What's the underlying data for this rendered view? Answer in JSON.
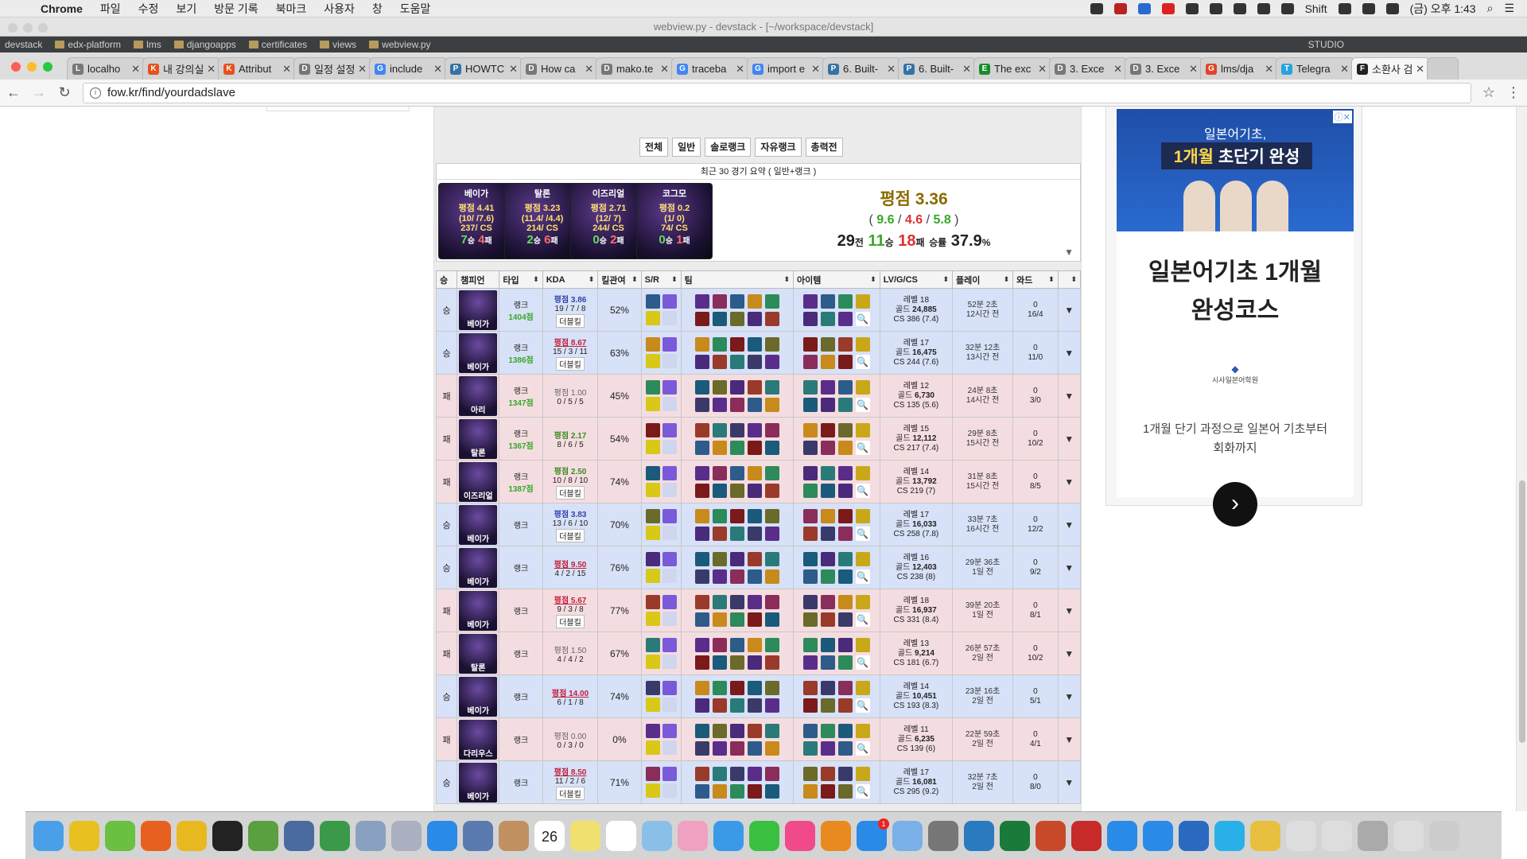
{
  "menubar": {
    "app": "Chrome",
    "items": [
      "파일",
      "수정",
      "보기",
      "방문 기록",
      "북마크",
      "사용자",
      "창",
      "도움말"
    ],
    "shift": "Shift",
    "clock": "(금) 오후 1:43"
  },
  "ide": {
    "title": "webview.py - devstack - [~/workspace/devstack]",
    "crumbs": [
      "devstack",
      "edx-platform",
      "lms",
      "djangoapps",
      "certificates",
      "views",
      "webview.py"
    ],
    "run_config": "STUDIO"
  },
  "tabs": [
    {
      "title": "localho",
      "fav": "L",
      "color": "#777"
    },
    {
      "title": "내 강의실",
      "fav": "K",
      "color": "#e8501c"
    },
    {
      "title": "Attribut",
      "fav": "K",
      "color": "#e8501c"
    },
    {
      "title": "일정 설정",
      "fav": "D",
      "color": "#777"
    },
    {
      "title": "include",
      "fav": "G",
      "color": "#4285f4"
    },
    {
      "title": "HOWTC",
      "fav": "P",
      "color": "#3572a5"
    },
    {
      "title": "How ca",
      "fav": "D",
      "color": "#777"
    },
    {
      "title": "mako.te",
      "fav": "D",
      "color": "#777"
    },
    {
      "title": "traceba",
      "fav": "G",
      "color": "#4285f4"
    },
    {
      "title": "import e",
      "fav": "G",
      "color": "#4285f4"
    },
    {
      "title": "6. Built-",
      "fav": "P",
      "color": "#3572a5"
    },
    {
      "title": "6. Built-",
      "fav": "P",
      "color": "#3572a5"
    },
    {
      "title": "The exc",
      "fav": "E",
      "color": "#1b8a2a"
    },
    {
      "title": "3. Exce",
      "fav": "D",
      "color": "#777"
    },
    {
      "title": "3. Exce",
      "fav": "D",
      "color": "#777"
    },
    {
      "title": "lms/dja",
      "fav": "G",
      "color": "#e24329"
    },
    {
      "title": "Telegra",
      "fav": "T",
      "color": "#2aa2de"
    },
    {
      "title": "소환사 검",
      "fav": "F",
      "color": "#222",
      "active": true
    }
  ],
  "address": {
    "url": "fow.kr/find/yourdadslave"
  },
  "filters": [
    "전체",
    "일반",
    "솔로랭크",
    "자유랭크",
    "총력전"
  ],
  "summary": {
    "title": "최근 30 경기 요약 ( 일반+랭크 )",
    "cards": [
      {
        "name": "베이가",
        "rating": "평점 4.41",
        "kda": "(10/ /7.6)",
        "cs": "237/ CS",
        "wins": "7",
        "win_label": "승",
        "losses": "4",
        "loss_label": "패"
      },
      {
        "name": "탈론",
        "rating": "평점 3.23",
        "kda": "(11.4/ /4.4)",
        "cs": "214/ CS",
        "wins": "2",
        "win_label": "승",
        "losses": "6",
        "loss_label": "패"
      },
      {
        "name": "이즈리얼",
        "rating": "평점 2.71",
        "kda": "(12/ 7)",
        "cs": "244/ CS",
        "wins": "0",
        "win_label": "승",
        "losses": "2",
        "loss_label": "패"
      },
      {
        "name": "코그모",
        "rating": "평점 0.2",
        "kda": "(1/ 0)",
        "cs": "74/ CS",
        "wins": "0",
        "win_label": "승",
        "losses": "1",
        "loss_label": "패"
      }
    ],
    "rating": "평점 3.36",
    "kda_open": "(",
    "kda_k": "9.6",
    "kda_d": "4.6",
    "kda_a": "5.8",
    "kda_close": ")",
    "games": "29",
    "games_label": "전",
    "wins": "11",
    "wins_label": "승",
    "losses": "18",
    "losses_label": "패",
    "rate_label": "승률",
    "rate": "37.9",
    "rate_unit": "%",
    "arrow": "▼"
  },
  "table": {
    "headers": [
      "승",
      "챔피언",
      "타입",
      "KDA",
      "킬관여",
      "S/R",
      "팀",
      "아이템",
      "LV/G/CS",
      "플레이",
      "와드",
      ""
    ],
    "rows": [
      {
        "result": "승",
        "win": true,
        "champ": "베이가",
        "type": "랭크",
        "lp": "1404점",
        "rating": "평점 3.86",
        "rclass": "mid",
        "kda": "19 / 7 / 8",
        "tag": "더블킬",
        "kp": "52%",
        "level": "레벨 18",
        "gold_label": "골드",
        "gold": "24,885",
        "cs": "CS 386 (7.4)",
        "dur": "52분 2초",
        "ago": "12시간 전",
        "ward1": "0",
        "ward2": "16/4"
      },
      {
        "result": "승",
        "win": true,
        "champ": "베이가",
        "type": "랭크",
        "lp": "1386점",
        "rating": "평점 8.67",
        "rclass": "hi",
        "kda": "15 / 3 / 11",
        "tag": "더블킬",
        "kp": "63%",
        "level": "레벨 17",
        "gold_label": "골드",
        "gold": "16,475",
        "cs": "CS 244 (7.6)",
        "dur": "32분 12초",
        "ago": "13시간 전",
        "ward1": "0",
        "ward2": "11/0"
      },
      {
        "result": "패",
        "win": false,
        "champ": "아리",
        "type": "랭크",
        "lp": "1347점",
        "rating": "평점 1.00",
        "rclass": "low",
        "kda": "0 / 5 / 5",
        "tag": "",
        "kp": "45%",
        "level": "레벨 12",
        "gold_label": "골드",
        "gold": "6,730",
        "cs": "CS 135 (5.6)",
        "dur": "24분 8초",
        "ago": "14시간 전",
        "ward1": "0",
        "ward2": "3/0"
      },
      {
        "result": "패",
        "win": false,
        "champ": "탈론",
        "type": "랭크",
        "lp": "1367점",
        "rating": "평점 2.17",
        "rclass": "good",
        "kda": "8 / 6 / 5",
        "tag": "",
        "kp": "54%",
        "level": "레벨 15",
        "gold_label": "골드",
        "gold": "12,112",
        "cs": "CS 217 (7.4)",
        "dur": "29분 8초",
        "ago": "15시간 전",
        "ward1": "0",
        "ward2": "10/2"
      },
      {
        "result": "패",
        "win": false,
        "champ": "이즈리얼",
        "type": "랭크",
        "lp": "1387점",
        "rating": "평점 2.50",
        "rclass": "good",
        "kda": "10 / 8 / 10",
        "tag": "더블킬",
        "kp": "74%",
        "level": "레벨 14",
        "gold_label": "골드",
        "gold": "13,792",
        "cs": "CS 219 (7)",
        "dur": "31분 8초",
        "ago": "15시간 전",
        "ward1": "0",
        "ward2": "8/5"
      },
      {
        "result": "승",
        "win": true,
        "champ": "베이가",
        "type": "랭크",
        "lp": "",
        "rating": "평점 3.83",
        "rclass": "mid",
        "kda": "13 / 6 / 10",
        "tag": "더블킬",
        "kp": "70%",
        "level": "레벨 17",
        "gold_label": "골드",
        "gold": "16,033",
        "cs": "CS 258 (7.8)",
        "dur": "33분 7초",
        "ago": "16시간 전",
        "ward1": "0",
        "ward2": "12/2"
      },
      {
        "result": "승",
        "win": true,
        "champ": "베이가",
        "type": "랭크",
        "lp": "",
        "rating": "평점 9.50",
        "rclass": "hi",
        "kda": "4 / 2 / 15",
        "tag": "",
        "kp": "76%",
        "level": "레벨 16",
        "gold_label": "골드",
        "gold": "12,403",
        "cs": "CS 238 (8)",
        "dur": "29분 36초",
        "ago": "1일 전",
        "ward1": "0",
        "ward2": "9/2"
      },
      {
        "result": "패",
        "win": false,
        "champ": "베이가",
        "type": "랭크",
        "lp": "",
        "rating": "평점 5.67",
        "rclass": "hi",
        "kda": "9 / 3 / 8",
        "tag": "더블킬",
        "kp": "77%",
        "level": "레벨 18",
        "gold_label": "골드",
        "gold": "16,937",
        "cs": "CS 331 (8.4)",
        "dur": "39분 20초",
        "ago": "1일 전",
        "ward1": "0",
        "ward2": "8/1"
      },
      {
        "result": "패",
        "win": false,
        "champ": "탈론",
        "type": "랭크",
        "lp": "",
        "rating": "평점 1.50",
        "rclass": "low",
        "kda": "4 / 4 / 2",
        "tag": "",
        "kp": "67%",
        "level": "레벨 13",
        "gold_label": "골드",
        "gold": "9,214",
        "cs": "CS 181 (6.7)",
        "dur": "26분 57초",
        "ago": "2일 전",
        "ward1": "0",
        "ward2": "10/2"
      },
      {
        "result": "승",
        "win": true,
        "champ": "베이가",
        "type": "랭크",
        "lp": "",
        "rating": "평점 14.00",
        "rclass": "hi",
        "kda": "6 / 1 / 8",
        "tag": "",
        "kp": "74%",
        "level": "레벨 14",
        "gold_label": "골드",
        "gold": "10,451",
        "cs": "CS 193 (8.3)",
        "dur": "23분 16초",
        "ago": "2일 전",
        "ward1": "0",
        "ward2": "5/1"
      },
      {
        "result": "패",
        "win": false,
        "champ": "다리우스",
        "type": "랭크",
        "lp": "",
        "rating": "평점 0.00",
        "rclass": "low",
        "kda": "0 / 3 / 0",
        "tag": "",
        "kp": "0%",
        "level": "레벨 11",
        "gold_label": "골드",
        "gold": "6,235",
        "cs": "CS 139 (6)",
        "dur": "22분 59초",
        "ago": "2일 전",
        "ward1": "0",
        "ward2": "4/1"
      },
      {
        "result": "승",
        "win": true,
        "champ": "베이가",
        "type": "랭크",
        "lp": "",
        "rating": "평점 8.50",
        "rclass": "hi",
        "kda": "11 / 2 / 6",
        "tag": "더블킬",
        "kp": "71%",
        "level": "레벨 17",
        "gold_label": "골드",
        "gold": "16,081",
        "cs": "CS 295 (9.2)",
        "dur": "32분 7초",
        "ago": "2일 전",
        "ward1": "0",
        "ward2": "8/0"
      }
    ],
    "expand_glyph": "▼",
    "sort_glyph": "⬍"
  },
  "ad": {
    "img_small": "일본어기초,",
    "img_big_pre": "1개월",
    "img_big_post": " 초단기 완성",
    "choice": "ⓘ✕",
    "headline1": "일본어기초 1개월",
    "headline2": "완성코스",
    "logo": "시사일본어학원",
    "desc1": "1개월 단기 과정으로 일본어 기초부터",
    "desc2": "회화까지",
    "btn": "›"
  },
  "dock": {
    "calendar_day": "26",
    "appstore_badge": "1",
    "icons": [
      "finder-icon",
      "chrome-icon",
      "rocket-icon",
      "firefox-icon",
      "bee-icon",
      "terminal-icon",
      "frog-icon",
      "package-icon",
      "anaconda-icon",
      "database-icon",
      "launchpad-icon",
      "safari-icon",
      "xcode-icon",
      "contacts-icon",
      "calendar-icon",
      "notes-icon",
      "reminders-icon",
      "preview-icon",
      "photos-icon",
      "messages-icon",
      "facetime-icon",
      "itunes-icon",
      "books-icon",
      "appstore-icon",
      "weather-icon",
      "settings-icon",
      "docker-icon",
      "excel-icon",
      "powerpoint-icon",
      "remote-desktop-icon",
      "windows-icon",
      "teamviewer-icon",
      "edge-icon",
      "ie-icon",
      "folder-icon",
      "files-icon",
      "screen-icon",
      "desktop-icon",
      "chrome-app-icon",
      "trash-icon"
    ]
  },
  "colors": {
    "win_row": "#d7e1f7",
    "loss_row": "#f4dde0",
    "accent_green": "#38a828",
    "accent_red": "#e03030"
  }
}
